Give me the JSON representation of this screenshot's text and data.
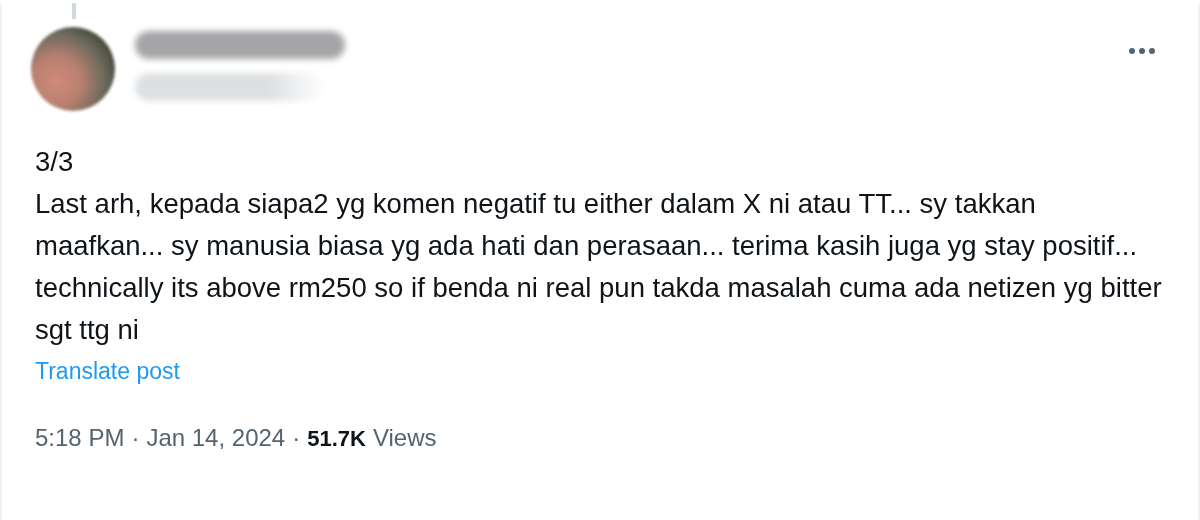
{
  "post": {
    "text_lines": [
      "3/3",
      "Last arh, kepada siapa2 yg komen negatif tu either dalam X ni atau TT... sy takkan maafkan... sy manusia biasa yg ada hati dan perasaan... terima kasih juga yg stay positif... technically its above rm250 so if benda ni real pun takda masalah cuma ada netizen yg bitter sgt ttg ni"
    ],
    "translate_link": "Translate post",
    "time": "5:18 PM",
    "separator_1": "·",
    "date": "Jan 14, 2024",
    "separator_2": "·",
    "views_count": "51.7K",
    "views_label": "Views"
  }
}
